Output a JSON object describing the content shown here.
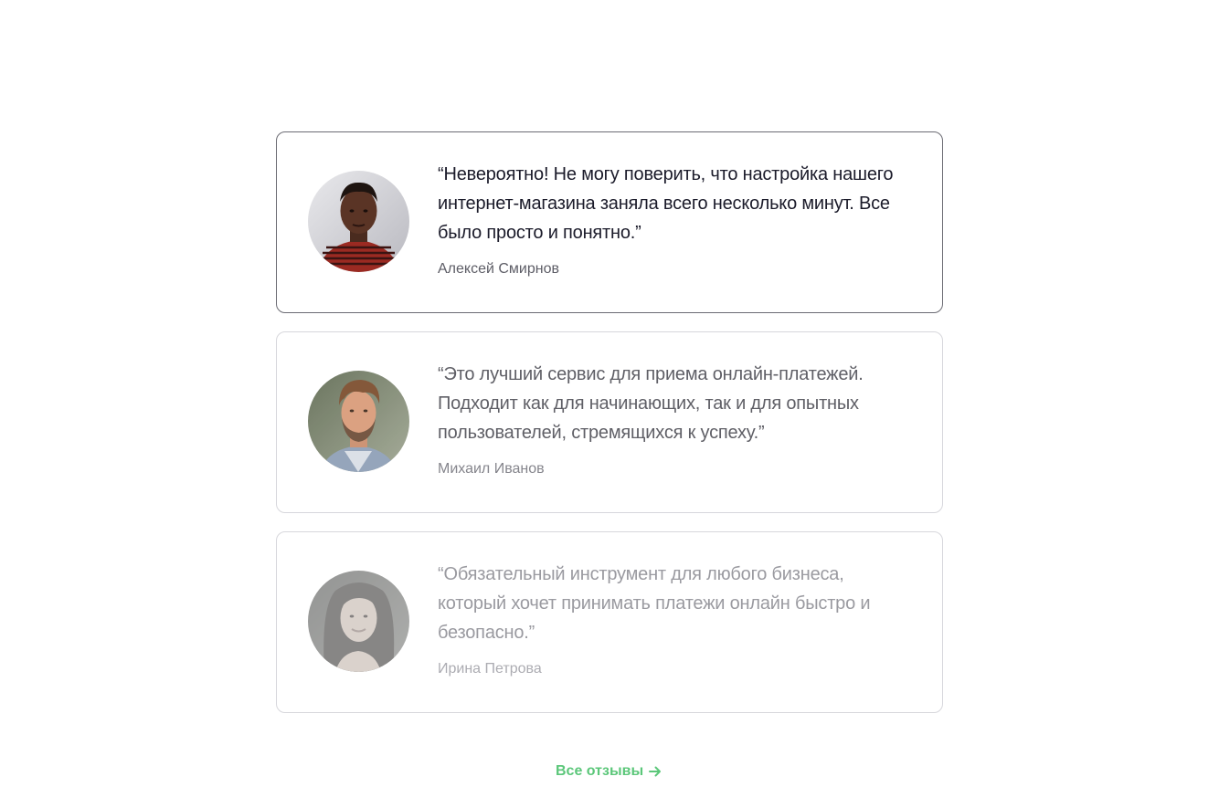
{
  "testimonials": [
    {
      "quote": "“Невероятно! Не могу поверить, что настройка нашего интернет-магазина заняла всего несколько минут. Все было просто и понятно.”",
      "author": "Алексей Смирнов",
      "avatar_icon": "person-portrait-icon"
    },
    {
      "quote": "“Это лучший сервис для приема онлайн-платежей. Подходит как для начинающих, так и для опытных пользователей, стремящихся к успеху.”",
      "author": "Михаил Иванов",
      "avatar_icon": "person-portrait-icon"
    },
    {
      "quote": "“Обязательный инструмент для любого бизнеса, который хочет принимать платежи онлайн быстро и безопасно.”",
      "author": "Ирина Петрова",
      "avatar_icon": "person-portrait-icon"
    }
  ],
  "footer": {
    "all_reviews_label": "Все отзывы",
    "arrow_icon": "arrow-right-icon"
  },
  "colors": {
    "accent": "#5cc77a",
    "active_border": "#6b6b73",
    "border": "#d7d7dc"
  }
}
